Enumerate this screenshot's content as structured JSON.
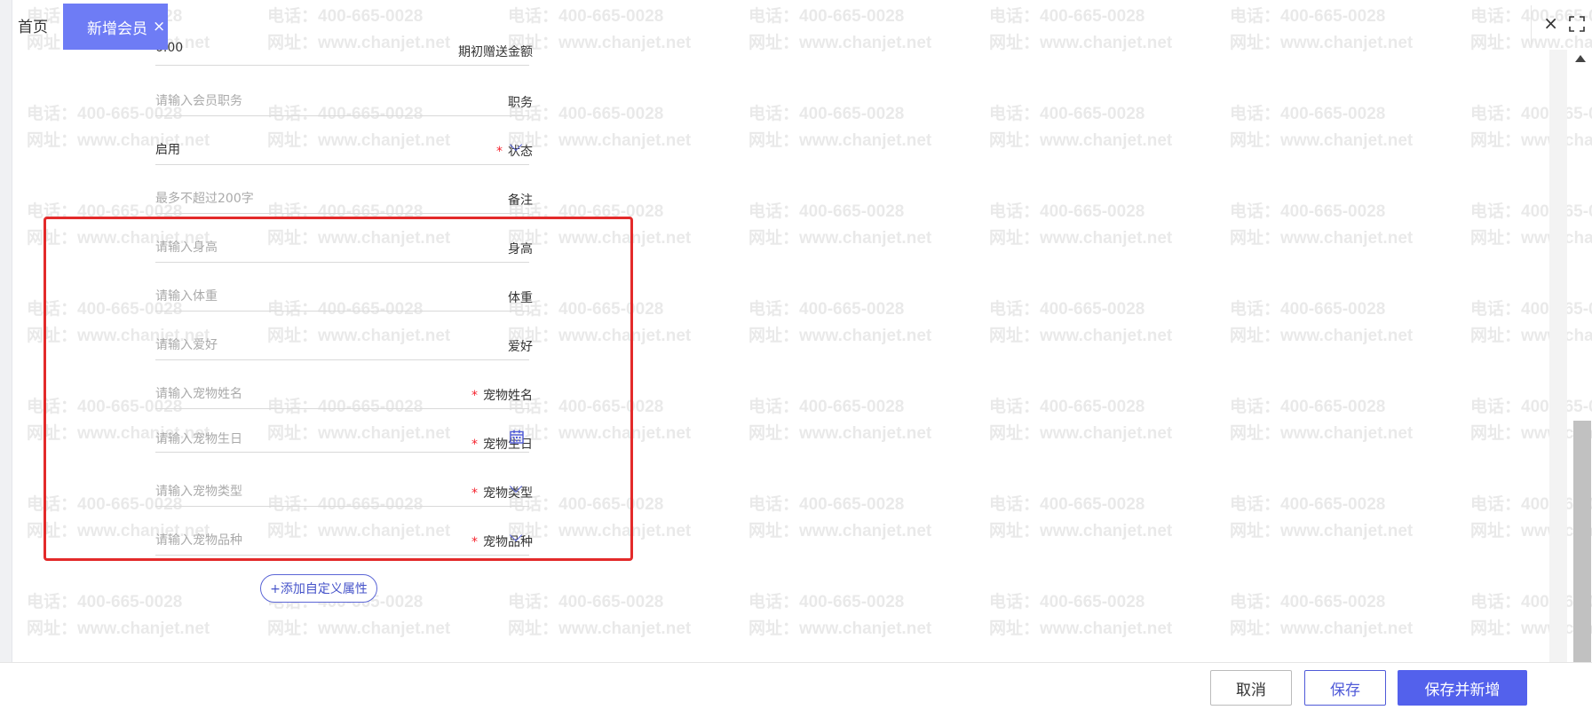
{
  "tabs": {
    "home_label": "首页",
    "active_label": "新增会员",
    "active_close": "×"
  },
  "window": {
    "close_label": "×",
    "fullscreen_icon": "fullscreen-icon"
  },
  "watermark": {
    "phone": "电话：400-665-0028",
    "site": "网址：www.chanjet.net"
  },
  "form": {
    "initial_gift": {
      "label": "期初赠送金额",
      "value": "0.00"
    },
    "position": {
      "label": "职务",
      "placeholder": "请输入会员职务"
    },
    "status": {
      "label": "状态",
      "value": "启用",
      "required": true
    },
    "remark": {
      "label": "备注",
      "placeholder": "最多不超过200字"
    },
    "height": {
      "label": "身高",
      "placeholder": "请输入身高"
    },
    "weight": {
      "label": "体重",
      "placeholder": "请输入体重"
    },
    "hobby": {
      "label": "爱好",
      "placeholder": "请输入爱好"
    },
    "pet_name": {
      "label": "宠物姓名",
      "placeholder": "请输入宠物姓名",
      "required": true
    },
    "pet_birthday": {
      "label": "宠物生日",
      "placeholder": "请输入宠物生日",
      "required": true
    },
    "pet_type": {
      "label": "宠物类型",
      "placeholder": "请输入宠物类型",
      "required": true
    },
    "pet_breed": {
      "label": "宠物品种",
      "placeholder": "请输入宠物品种",
      "required": true
    },
    "required_mark": "*"
  },
  "add_attribute": {
    "label": "+添加自定义属性"
  },
  "footer": {
    "cancel_label": "取消",
    "save_label": "保存",
    "save_new_label": "保存并新增"
  },
  "colors": {
    "accent": "#5361ec",
    "tab_active": "#6e7cf5",
    "required": "#f5222d",
    "highlight_box": "#e32a2a"
  }
}
